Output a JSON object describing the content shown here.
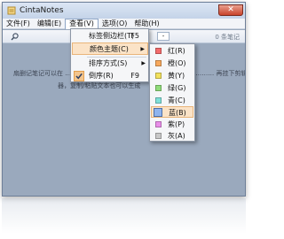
{
  "window": {
    "title": "CintaNotes",
    "close_label": "✕"
  },
  "menubar": {
    "items": [
      {
        "label": "文件(F)"
      },
      {
        "label": "编辑(E)"
      },
      {
        "label": "查看(V)"
      },
      {
        "label": "选项(O)"
      },
      {
        "label": "帮助(H)"
      }
    ]
  },
  "toolbar": {
    "count_text": "0 条笔记",
    "zoom_text": "-"
  },
  "content": {
    "hint_line1": "扇删记笔记可以在 ……………………………………………………………… 再挂下剪辑",
    "hint_line2": "器，复制/粘贴文本也可以生成"
  },
  "view_menu": {
    "items": [
      {
        "label": "标签侧边栏(T)",
        "shortcut": "F5"
      },
      {
        "label": "颜色主题(C)",
        "submenu_arrow": "▶"
      },
      {
        "label": "排序方式(S)",
        "submenu_arrow": "▶"
      },
      {
        "label": "倒序(R)",
        "shortcut": "F9"
      }
    ]
  },
  "color_submenu": {
    "items": [
      {
        "label": "红(R)",
        "color": "#f36b6b"
      },
      {
        "label": "橙(O)",
        "color": "#f7a85c"
      },
      {
        "label": "黄(Y)",
        "color": "#f2e15d"
      },
      {
        "label": "绿(G)",
        "color": "#8fdc79"
      },
      {
        "label": "青(C)",
        "color": "#7fe0d8"
      },
      {
        "label": "蓝(B)",
        "color": "#8fb4ee"
      },
      {
        "label": "紫(P)",
        "color": "#e98ee9"
      },
      {
        "label": "灰(A)",
        "color": "#c8c8c8"
      }
    ],
    "selected": "蓝(B)"
  }
}
